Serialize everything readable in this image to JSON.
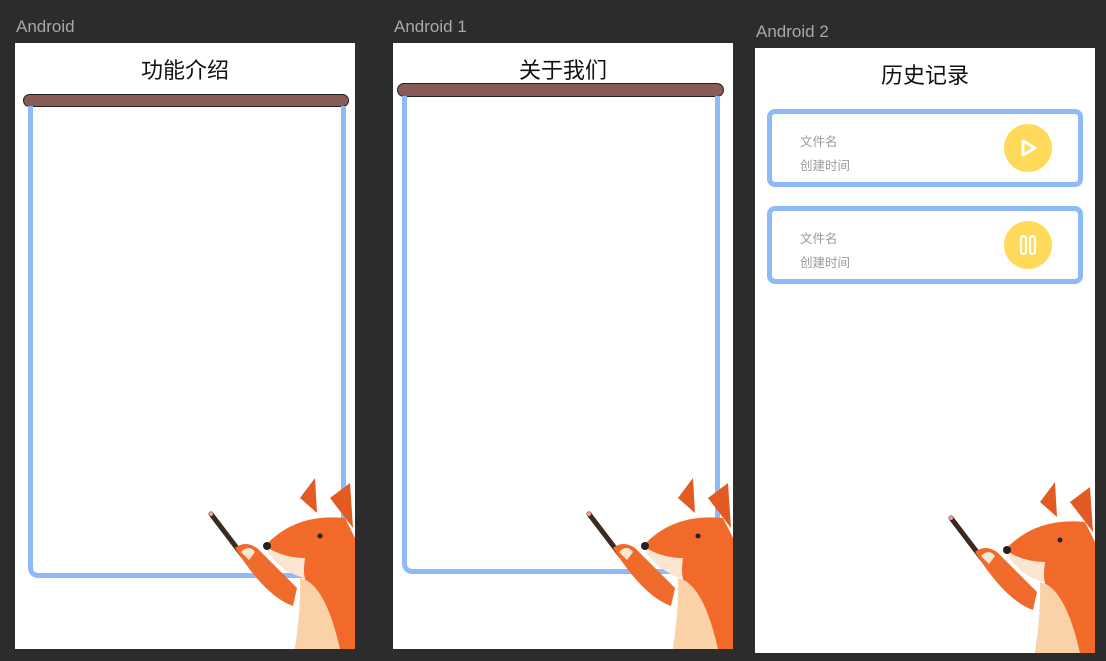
{
  "frames": [
    {
      "label": "Android",
      "title": "功能介绍"
    },
    {
      "label": "Android 1",
      "title": "关于我们"
    },
    {
      "label": "Android 2",
      "title": "历史记录",
      "records": [
        {
          "name": "文件名",
          "time": "创建时间",
          "action_icon": "play-icon"
        },
        {
          "name": "文件名",
          "time": "创建时间",
          "action_icon": "pause-icon"
        }
      ]
    }
  ],
  "colors": {
    "canvas": "#2c2c2c",
    "board_border": "#8fbaf8",
    "board_bar": "#8a5a57",
    "button": "#ffd95a",
    "fox": "#f26a2a"
  }
}
